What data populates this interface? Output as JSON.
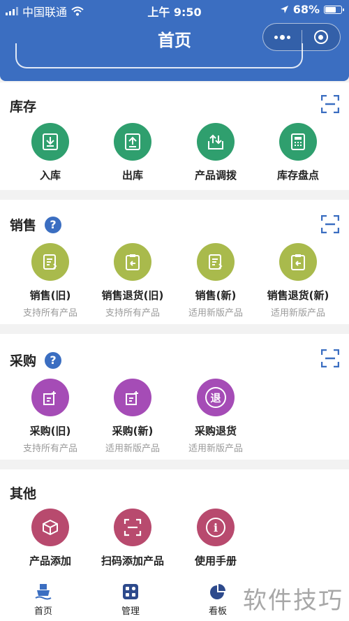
{
  "status_bar": {
    "carrier": "中国联通",
    "time": "上午 9:50",
    "battery": "68%",
    "battery_level": 0.68
  },
  "nav": {
    "title": "首页"
  },
  "colors": {
    "header": "#3b6ec1",
    "inventory": "#2f9f6e",
    "sales": "#a9ba4c",
    "purchase": "#a54cb6",
    "other": "#b84a6e"
  },
  "sections": {
    "inventory": {
      "title": "库存",
      "items": [
        {
          "label": "入库",
          "icon": "inbound-icon"
        },
        {
          "label": "出库",
          "icon": "outbound-icon"
        },
        {
          "label": "产品调拨",
          "icon": "transfer-icon"
        },
        {
          "label": "库存盘点",
          "icon": "stocktake-icon"
        }
      ]
    },
    "sales": {
      "title": "销售",
      "help": "?",
      "items": [
        {
          "label": "销售(旧)",
          "sub": "支持所有产品",
          "icon": "sales-old-icon"
        },
        {
          "label": "销售退货(旧)",
          "sub": "支持所有产品",
          "icon": "sales-return-old-icon"
        },
        {
          "label": "销售(新)",
          "sub": "适用新版产品",
          "icon": "sales-new-icon"
        },
        {
          "label": "销售退货(新)",
          "sub": "适用新版产品",
          "icon": "sales-return-new-icon"
        }
      ]
    },
    "purchase": {
      "title": "采购",
      "help": "?",
      "items": [
        {
          "label": "采购(旧)",
          "sub": "支持所有产品",
          "icon": "purchase-old-icon"
        },
        {
          "label": "采购(新)",
          "sub": "适用新版产品",
          "icon": "purchase-new-icon"
        },
        {
          "label": "采购退货",
          "sub": "适用新版产品",
          "icon": "purchase-return-icon",
          "glyph": "退"
        }
      ]
    },
    "other": {
      "title": "其他",
      "items": [
        {
          "label": "产品添加",
          "icon": "box-icon"
        },
        {
          "label": "扫码添加产品",
          "icon": "scan-add-icon"
        },
        {
          "label": "使用手册",
          "icon": "info-icon",
          "glyph": "i"
        }
      ]
    }
  },
  "tabbar": {
    "tabs": [
      {
        "label": "首页",
        "icon": "ship-icon",
        "active": true
      },
      {
        "label": "管理",
        "icon": "grid-icon",
        "active": false
      },
      {
        "label": "看板",
        "icon": "pie-chart-icon",
        "active": false
      }
    ]
  },
  "watermark": "软件技巧"
}
